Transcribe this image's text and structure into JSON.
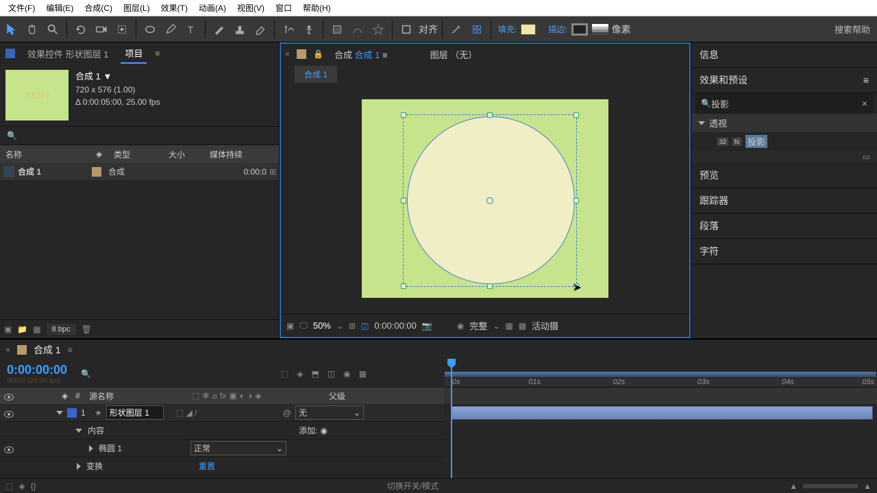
{
  "menu": [
    "文件(F)",
    "编辑(E)",
    "合成(C)",
    "图层(L)",
    "效果(T)",
    "动画(A)",
    "视图(V)",
    "窗口",
    "帮助(H)"
  ],
  "toolbar": {
    "align": "对齐",
    "fill": "填充:",
    "stroke": "描边:",
    "px": "像素",
    "search_help": "搜索帮助",
    "fill_swatch": "#f1e7a8",
    "stroke_swatch": "#222222"
  },
  "left": {
    "tab_effects": "效果控件 形状图层 1",
    "tab_project": "项目",
    "comp_title": "合成 1 ▼",
    "resolution": "720 x 576 (1.00)",
    "duration": "Δ 0:00:05:00, 25.00 fps",
    "thumb_text": "YES !",
    "headers": {
      "name": "名称",
      "type": "类型",
      "size": "大小",
      "media": "媒体持续"
    },
    "row": {
      "name": "合成 1",
      "type": "合成",
      "dur": "0:00:0"
    },
    "bpc": "8 bpc"
  },
  "center": {
    "tab_comp_label": "合成",
    "tab_comp_name": "合成 1",
    "tab_layer": "图层 （无）",
    "subtab": "合成 1",
    "zoom": "50%",
    "time": "0:00:00:00",
    "quality": "完整",
    "camera": "活动摄"
  },
  "right": {
    "info": "信息",
    "efx": "效果和预设",
    "search_value": "投影",
    "tree_parent": "透视",
    "tree_child": "投影",
    "preview": "预览",
    "tracker": "跟踪器",
    "paragraph": "段落",
    "char": "字符"
  },
  "timeline": {
    "tab": "合成 1",
    "timecode": "0:00:00:00",
    "subtime": "00000 (25.00 fps)",
    "headers": {
      "num": "#",
      "source": "源名称",
      "parent": "父级"
    },
    "layer1": {
      "num": "1",
      "name": "形状图层 1",
      "parent": "无"
    },
    "contents": "内容",
    "add": "添加:",
    "ellipse": "椭圆 1",
    "ellipse_mode": "正常",
    "transform": "变换",
    "reset": "重置",
    "ticks": [
      "0s",
      "01s",
      "02s",
      "03s",
      "04s",
      "05s"
    ],
    "footer": "切换开关/模式"
  }
}
